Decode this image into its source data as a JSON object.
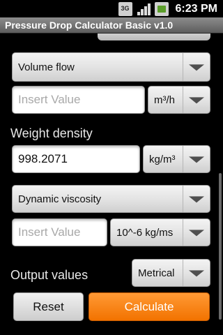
{
  "status_bar": {
    "network_badge": "3G",
    "time": "6:23 PM"
  },
  "app": {
    "title": "Pressure Drop Calculator Basic v1.0"
  },
  "form": {
    "flow_type": {
      "selected": "Volume flow"
    },
    "flow_value": {
      "value": "",
      "placeholder": "Insert Value"
    },
    "flow_unit": {
      "selected": "m³/h"
    },
    "density": {
      "label": "Weight density",
      "value": "998.2071",
      "unit": "kg/m³"
    },
    "viscosity_type": {
      "selected": "Dynamic viscosity"
    },
    "viscosity_value": {
      "value": "",
      "placeholder": "Insert Value"
    },
    "viscosity_unit": {
      "selected": "10^-6 kg/ms"
    },
    "output": {
      "label": "Output values",
      "unit": "Metrical"
    }
  },
  "actions": {
    "reset_label": "Reset",
    "calculate_label": "Calculate"
  },
  "colors": {
    "accent": "#f27300",
    "titlebar": "#6f6f6f"
  }
}
